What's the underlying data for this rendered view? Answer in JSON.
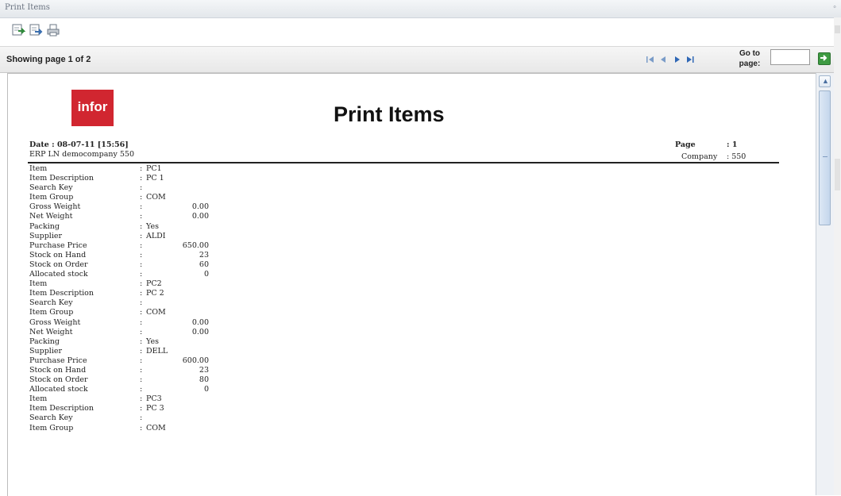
{
  "window": {
    "title": "Print Items"
  },
  "toolbar": {
    "buttons": [
      {
        "icon": "export-icon"
      },
      {
        "icon": "export-alt-icon"
      },
      {
        "icon": "print-icon"
      }
    ]
  },
  "navigation": {
    "showing_text": "Showing page 1 of 2",
    "goto_label": "Go to page:",
    "goto_value": ""
  },
  "report": {
    "logo_text": "infor",
    "title": "Print Items",
    "date_line": "Date   : 08-07-11 [15:56]",
    "company_line": "ERP LN democompany 550",
    "page_label": "Page",
    "page_value": ": 1",
    "company_label": "Company",
    "company_value": ":  550",
    "rows": [
      {
        "label": "Item",
        "colon": ":",
        "value": "PC1"
      },
      {
        "label": "Item Description",
        "colon": ":",
        "value": "PC 1"
      },
      {
        "label": "Search Key",
        "colon": ":",
        "value": ""
      },
      {
        "label": "Item Group",
        "colon": ":",
        "value": "COM"
      },
      {
        "label": "Gross Weight",
        "colon": ":",
        "num": "0.00"
      },
      {
        "label": "Net Weight",
        "colon": ":",
        "num": "0.00"
      },
      {
        "label": "Packing",
        "colon": ":",
        "value": "Yes"
      },
      {
        "label": "Supplier",
        "colon": ":",
        "value": "ALDI"
      },
      {
        "label": "Purchase Price",
        "colon": ":",
        "num": "650.00"
      },
      {
        "label": "Stock on Hand",
        "colon": ":",
        "num": "23"
      },
      {
        "label": "Stock on Order",
        "colon": ":",
        "num": "60"
      },
      {
        "label": "Allocated stock",
        "colon": ":",
        "num": "0"
      },
      {
        "label": "Item",
        "colon": ":",
        "value": "PC2"
      },
      {
        "label": "Item Description",
        "colon": ":",
        "value": "PC 2"
      },
      {
        "label": "Search Key",
        "colon": ":",
        "value": ""
      },
      {
        "label": "Item Group",
        "colon": ":",
        "value": "COM"
      },
      {
        "label": "Gross Weight",
        "colon": ":",
        "num": "0.00"
      },
      {
        "label": "Net Weight",
        "colon": ":",
        "num": "0.00"
      },
      {
        "label": "Packing",
        "colon": ":",
        "value": "Yes"
      },
      {
        "label": "Supplier",
        "colon": ":",
        "value": "DELL"
      },
      {
        "label": "Purchase Price",
        "colon": ":",
        "num": "600.00"
      },
      {
        "label": "Stock on Hand",
        "colon": ":",
        "num": "23"
      },
      {
        "label": "Stock on Order",
        "colon": ":",
        "num": "80"
      },
      {
        "label": "Allocated stock",
        "colon": ":",
        "num": "0"
      },
      {
        "label": "Item",
        "colon": ":",
        "value": "PC3"
      },
      {
        "label": "Item Description",
        "colon": ":",
        "value": "PC 3"
      },
      {
        "label": "Search Key",
        "colon": ":",
        "value": ""
      },
      {
        "label": "Item Group",
        "colon": ":",
        "value": "COM"
      }
    ]
  },
  "colors": {
    "logo_red": "#d12630",
    "go_green": "#3e9a42",
    "nav_blue": "#3a6fb0"
  }
}
